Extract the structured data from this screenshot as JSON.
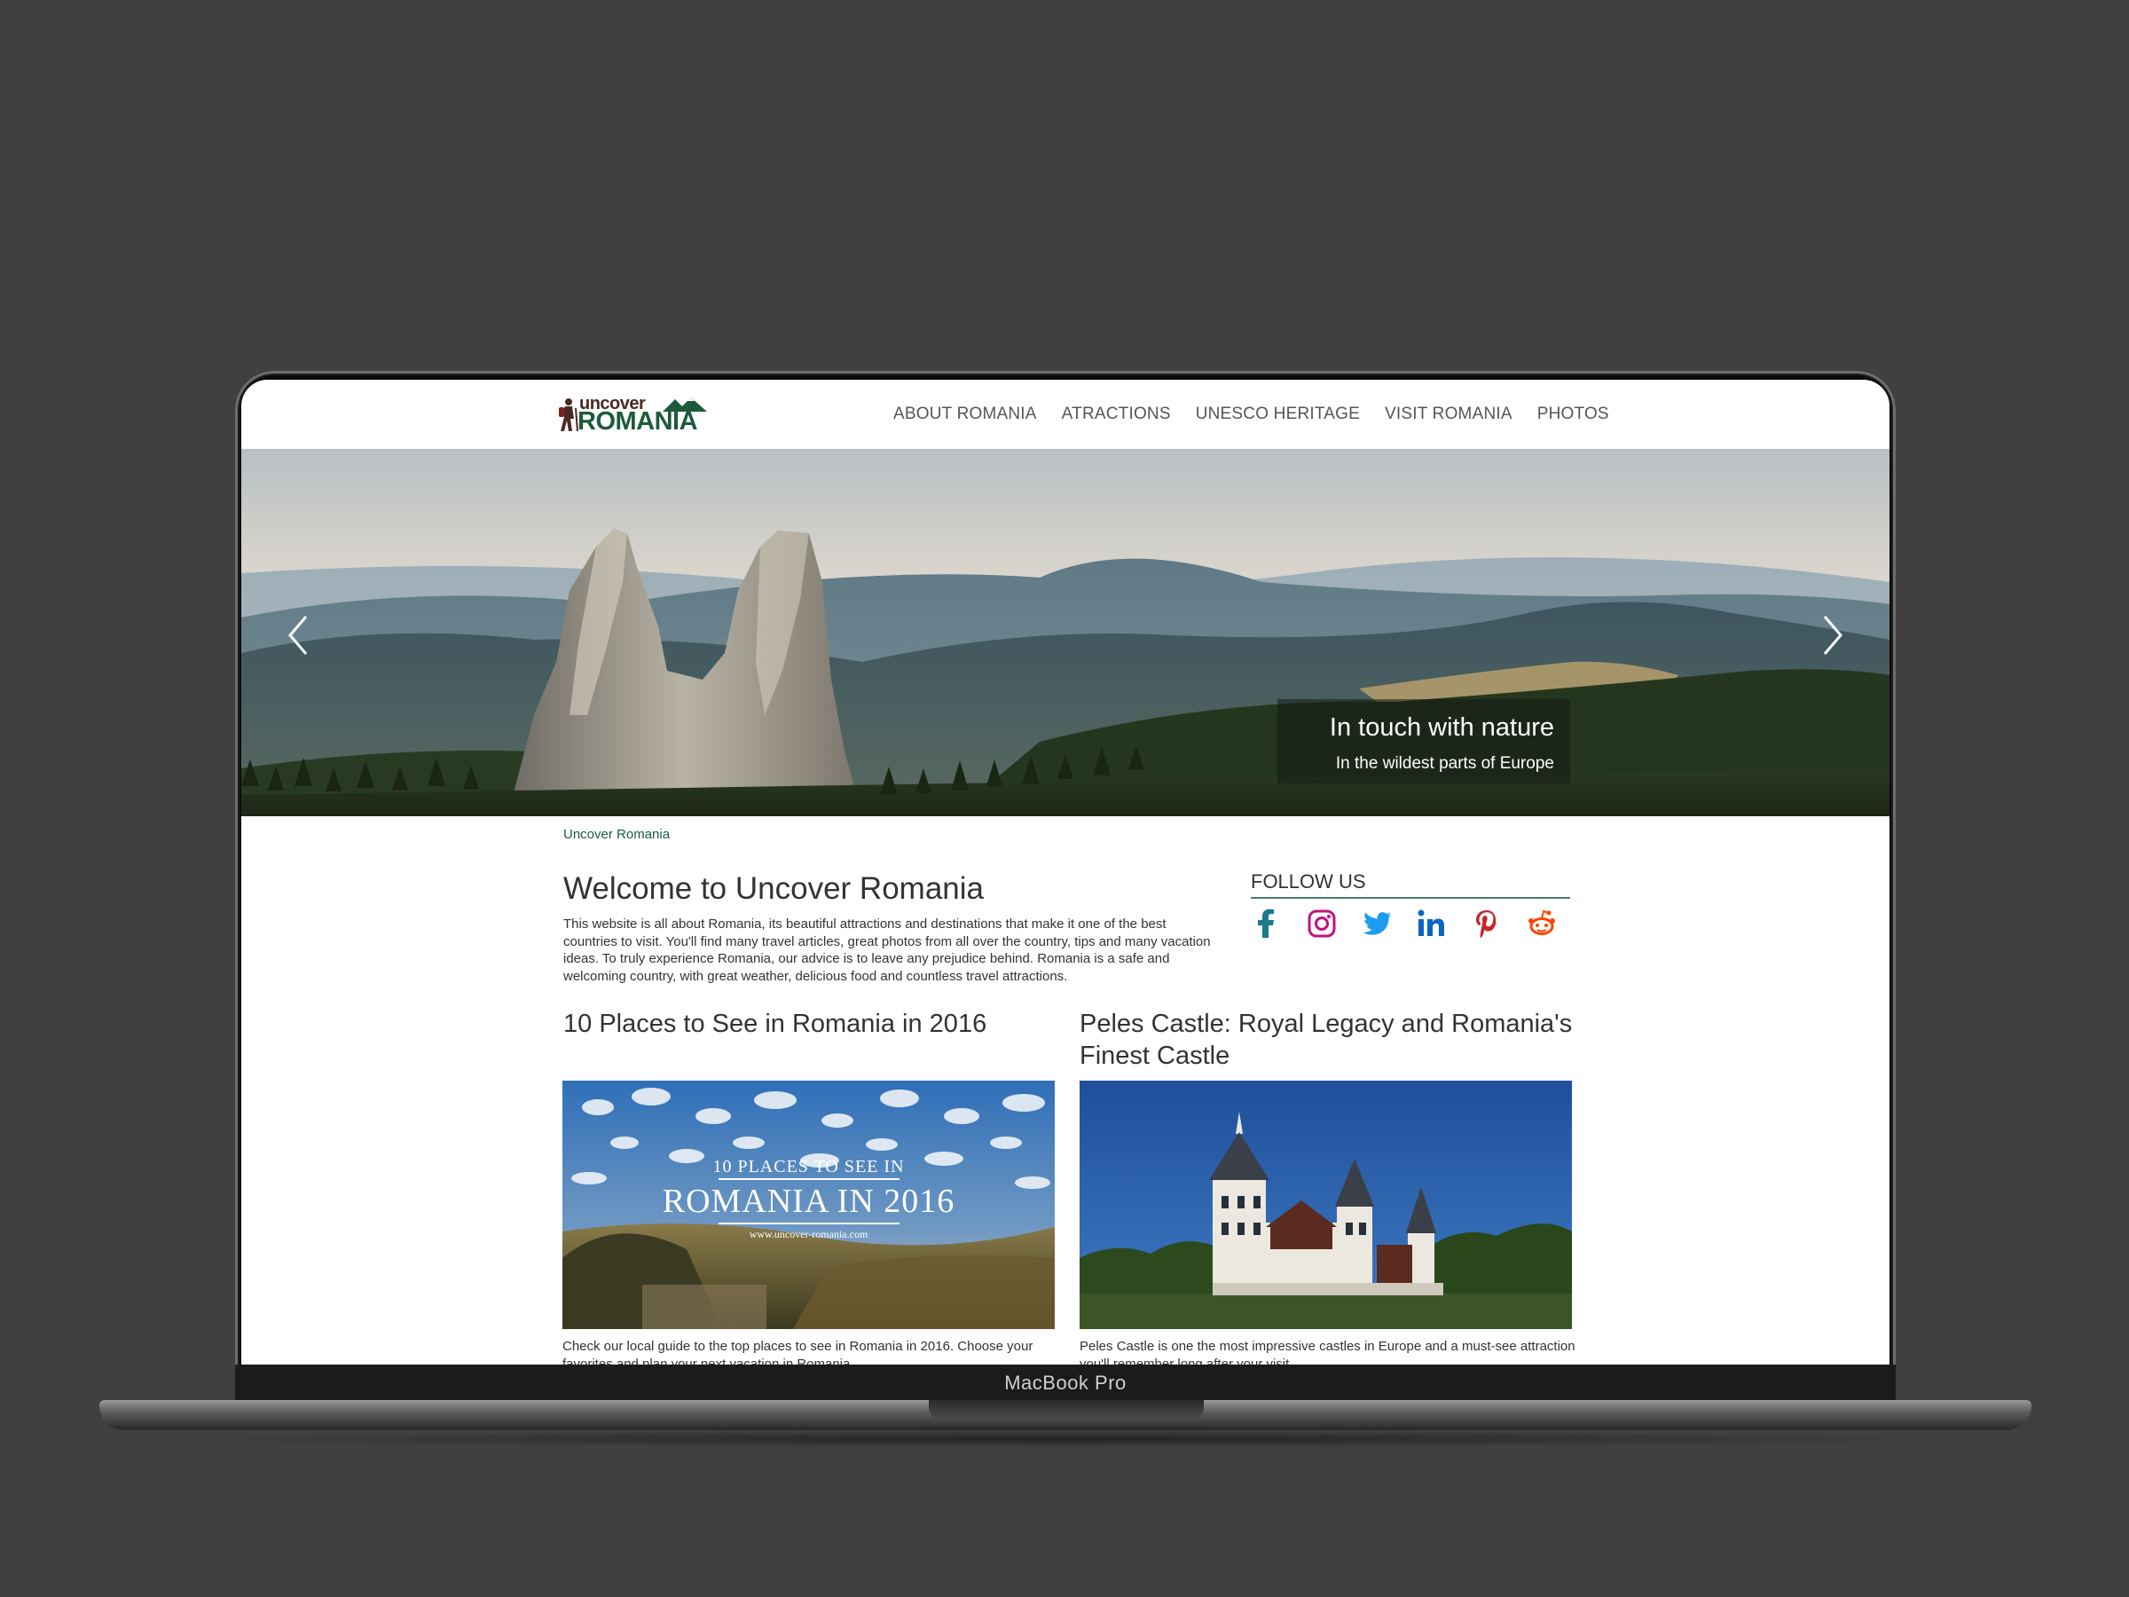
{
  "device": {
    "label": "MacBook Pro"
  },
  "header": {
    "logo": {
      "line1": "uncover",
      "line2": "ROMANIA"
    },
    "nav": [
      "ABOUT ROMANIA",
      "ATRACTIONS",
      "UNESCO HERITAGE",
      "VISIT ROMANIA",
      "PHOTOS"
    ]
  },
  "hero": {
    "caption_title": "In touch with nature",
    "caption_subtitle": "In the wildest parts of Europe",
    "prev_icon": "chevron-left-icon",
    "next_icon": "chevron-right-icon"
  },
  "breadcrumb": "Uncover Romania",
  "intro": {
    "title": "Welcome to Uncover Romania",
    "text": "This website is all about Romania, its beautiful attractions and destinations that make it one of the best countries to visit. You'll find many travel articles, great photos from all over the country, tips and many vacation ideas. To truly experience Romania, our advice is to leave any prejudice behind. Romania is a safe and welcoming country, with great weather, delicious food and countless travel attractions."
  },
  "follow": {
    "title": "FOLLOW US",
    "icons": [
      "facebook-icon",
      "instagram-icon",
      "twitter-icon",
      "linkedin-icon",
      "pinterest-icon",
      "reddit-icon"
    ]
  },
  "articles": [
    {
      "title": "10 Places to See in Romania in 2016",
      "image_text_small": "10 PLACES TO SEE IN",
      "image_text_big": "ROMANIA IN 2016",
      "image_text_url": "www.uncover-romania.com",
      "excerpt": "Check our local guide to the top places to see in Romania in 2016. Choose your favorites and plan your next vacation in Romania."
    },
    {
      "title": "Peles Castle: Royal Legacy and Romania's Finest Castle",
      "excerpt": "Peles Castle is one the most impressive castles in Europe and a must-see attraction you'll remember long after your visit."
    }
  ],
  "colors": {
    "background": "#404040",
    "brand_green": "#1d5b3a",
    "brand_brown": "#4a2a22",
    "text": "#333333"
  }
}
